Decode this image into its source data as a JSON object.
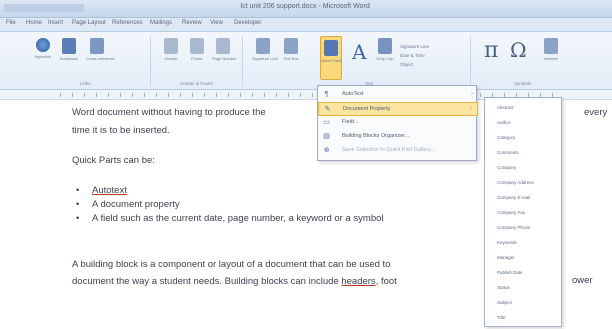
{
  "window": {
    "title": "Ict unit 206 support.docx - Microsoft Word"
  },
  "tabs": [
    "File",
    "Home",
    "Insert",
    "Page Layout",
    "References",
    "Mailings",
    "Review",
    "View",
    "Developer"
  ],
  "ribbon": {
    "buttons": [
      {
        "name": "hyperlink-button",
        "label": "Hyperlink",
        "color": "#3a6fb2"
      },
      {
        "name": "bookmark-button",
        "label": "Bookmark",
        "color": "#5b7fb5"
      },
      {
        "name": "cross-reference-button",
        "label": "Cross-reference",
        "color": "#7b97c2"
      },
      {
        "name": "header-button",
        "label": "Header",
        "color": "#a8b8cf"
      },
      {
        "name": "footer-button",
        "label": "Footer",
        "color": "#a8b8cf"
      },
      {
        "name": "page-number-button",
        "label": "Page Number",
        "color": "#a8b8cf"
      },
      {
        "name": "signature-line-button",
        "label": "Signature Line",
        "color": "#8aa2c4"
      },
      {
        "name": "text-box-button",
        "label": "Text Box",
        "color": "#8aa2c4"
      },
      {
        "name": "quick-parts-button",
        "label": "Quick Parts",
        "color": "#5479b0"
      },
      {
        "name": "wordart-button",
        "label": "WordArt",
        "color": "#3f65a8"
      },
      {
        "name": "drop-cap-button",
        "label": "Drop Cap",
        "color": "#7893bf"
      },
      {
        "name": "equation-button",
        "label": "Equation",
        "color": "#4a5e80"
      },
      {
        "name": "symbol-button",
        "label": "Symbol",
        "color": "#4a5e80"
      },
      {
        "name": "number-button",
        "label": "Number",
        "color": "#8aa2c4"
      }
    ],
    "small_items": [
      "Signature Line",
      "Date & Time",
      "Object"
    ],
    "groups": [
      "Links",
      "Header & Footer",
      "Text",
      "Symbols"
    ]
  },
  "quick_parts_menu": {
    "items": [
      {
        "label": "AutoText",
        "glyph": "¶",
        "arrow": "›",
        "highlighted": false,
        "disabled": false
      },
      {
        "label": "Document Property",
        "glyph": "✎",
        "arrow": "›",
        "highlighted": true,
        "disabled": false
      },
      {
        "label": "Field...",
        "glyph": "▭",
        "arrow": "",
        "highlighted": false,
        "disabled": false
      },
      {
        "label": "Building Blocks Organizer...",
        "glyph": "▤",
        "arrow": "",
        "highlighted": false,
        "disabled": false
      },
      {
        "label": "Save Selection to Quick Part Gallery...",
        "glyph": "⊕",
        "arrow": "",
        "highlighted": false,
        "disabled": true
      }
    ]
  },
  "document_property_submenu": {
    "items": [
      "Abstract",
      "Author",
      "Category",
      "Comments",
      "Company",
      "Company Address",
      "Company E-mail",
      "Company Fax",
      "Company Phone",
      "Keywords",
      "Manager",
      "Publish Date",
      "Status",
      "Subject",
      "Title"
    ]
  },
  "document": {
    "p1_line1": "Word document without having to produce the",
    "p1_tail": "every",
    "p1_line2": "time it is to be inserted.",
    "p2": "Quick Parts can be:",
    "bullet_glyph": "•",
    "bullets": [
      "Autotext",
      "A document property",
      "A field such as the current date, page number, a keyword or a symbol"
    ],
    "p3_line1": "A building block is a component or layout of a document that can be used to",
    "p3_line2_a": "document the way a student needs. Building blocks can include ",
    "p3_line2_headers": "headers",
    "p3_line2_b": ", foot",
    "p3_tail": "ower"
  }
}
